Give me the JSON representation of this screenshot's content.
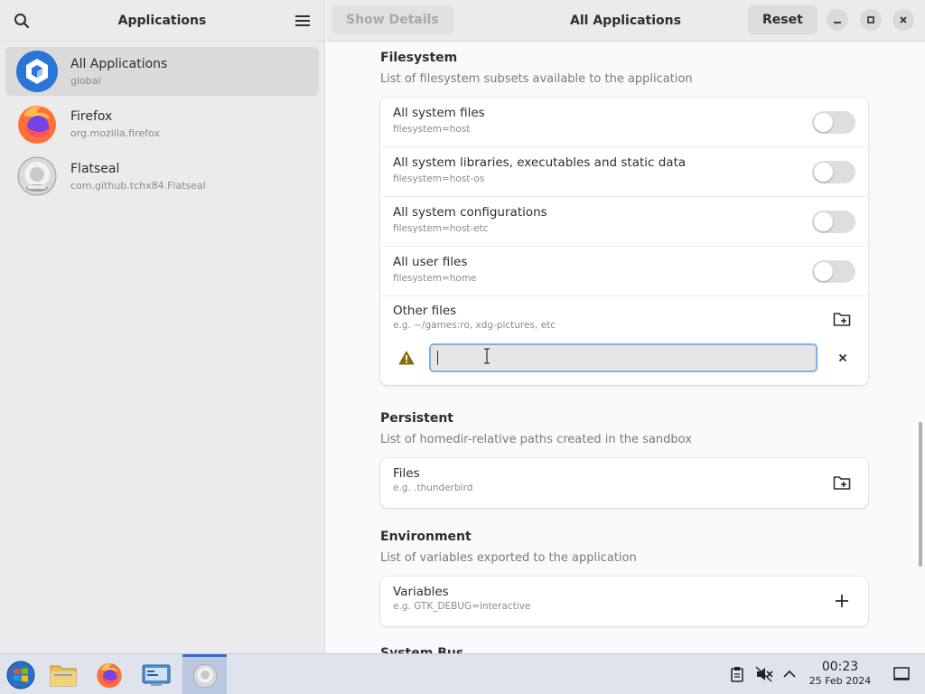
{
  "sidebar": {
    "title": "Applications",
    "apps": [
      {
        "name": "All Applications",
        "id": "global"
      },
      {
        "name": "Firefox",
        "id": "org.mozilla.firefox"
      },
      {
        "name": "Flatseal",
        "id": "com.github.tchx84.Flatseal"
      }
    ]
  },
  "header": {
    "show_details": "Show Details",
    "title": "All Applications",
    "reset": "Reset"
  },
  "filesystem": {
    "title": "Filesystem",
    "desc": "List of filesystem subsets available to the application",
    "rows": [
      {
        "title": "All system files",
        "sub": "filesystem=host"
      },
      {
        "title": "All system libraries, executables and static data",
        "sub": "filesystem=host-os"
      },
      {
        "title": "All system configurations",
        "sub": "filesystem=host-etc"
      },
      {
        "title": "All user files",
        "sub": "filesystem=home"
      }
    ],
    "other": {
      "title": "Other files",
      "sub": "e.g. ~/games:ro, xdg-pictures, etc"
    },
    "entry_value": ""
  },
  "persistent": {
    "title": "Persistent",
    "desc": "List of homedir-relative paths created in the sandbox",
    "row": {
      "title": "Files",
      "sub": "e.g. .thunderbird"
    }
  },
  "environment": {
    "title": "Environment",
    "desc": "List of variables exported to the application",
    "row": {
      "title": "Variables",
      "sub": "e.g. GTK_DEBUG=interactive"
    }
  },
  "next_section": {
    "title": "System Bus"
  },
  "taskbar": {
    "time": "00:23",
    "date": "25 Feb 2024"
  }
}
